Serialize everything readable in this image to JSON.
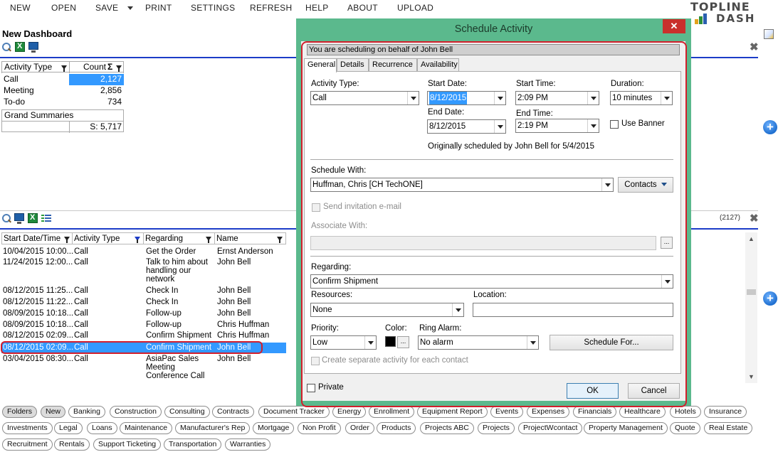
{
  "menu": {
    "items": [
      "NEW",
      "OPEN",
      "SAVE",
      "PRINT",
      "SETTINGS",
      "REFRESH",
      "HELP",
      "ABOUT",
      "UPLOAD"
    ]
  },
  "logo": {
    "line1": "TopLine",
    "line2": "Dash"
  },
  "dashboard": {
    "title": "New Dashboard",
    "pivot": {
      "col_activity": "Activity Type",
      "col_count": "Count",
      "rows": [
        {
          "type": "Call",
          "count": "2,127",
          "selected": true
        },
        {
          "type": "Meeting",
          "count": "2,856"
        },
        {
          "type": "To-do",
          "count": "734"
        }
      ],
      "grand_label": "Grand Summaries",
      "grand_value": "S: 5,717"
    },
    "list": {
      "count_badge": "(2127)",
      "headers": [
        "Start Date/Time",
        "Activity Type",
        "Regarding",
        "Name"
      ],
      "rows": [
        [
          "10/04/2015  10:00...",
          "Call",
          "Get the Order",
          "Ernst Anderson"
        ],
        [
          "11/24/2015  12:00...",
          "Call",
          "Talk to him about handling our network",
          "John Bell"
        ],
        [
          "08/12/2015  11:25...",
          "Call",
          "Check In",
          "John Bell"
        ],
        [
          "08/12/2015  11:22...",
          "Call",
          "Check In",
          "John Bell"
        ],
        [
          "08/09/2015  10:18...",
          "Call",
          "Follow-up",
          "John Bell"
        ],
        [
          "08/09/2015  10:18...",
          "Call",
          "Follow-up",
          "Chris Huffman"
        ],
        [
          "08/12/2015  02:09...",
          "Call",
          "Confirm Shipment",
          "Chris Huffman"
        ],
        [
          "08/12/2015  02:09...",
          "Call",
          "Confirm Shipment",
          "John Bell"
        ],
        [
          "03/04/2015  08:30...",
          "Call",
          "AsiaPac Sales Meeting Conference Call",
          "John Bell"
        ]
      ],
      "selected_index": 7
    }
  },
  "tags": {
    "row1": [
      "Folders",
      "New",
      "Banking",
      "Construction",
      "Consulting",
      "Contracts",
      "Document Tracker",
      "Energy",
      "Enrollment",
      "Equipment Report",
      "Events",
      "Expenses",
      "Financials",
      "Healthcare",
      "Hotels",
      "Insurance"
    ],
    "row2": [
      "Investments",
      "Legal",
      "Loans",
      "Maintenance",
      "Manufacturer's Rep",
      "Mortgage",
      "Non Profit",
      "Order",
      "Products",
      "Projects ABC",
      "Projects",
      "ProjectWcontact",
      "Property Management",
      "Quote",
      "Real Estate"
    ],
    "row3": [
      "Recruitment",
      "Rentals",
      "Support Ticketing",
      "Transportation",
      "Warranties"
    ],
    "active": [
      "Folders",
      "New"
    ]
  },
  "dialog": {
    "title": "Schedule Activity",
    "close": "✕",
    "behalf": "You are scheduling on behalf of John Bell",
    "tabs": [
      "General",
      "Details",
      "Recurrence",
      "Availability"
    ],
    "activity_type_label": "Activity Type:",
    "activity_type": "Call",
    "start_date_label": "Start Date:",
    "start_date": "8/12/2015",
    "start_time_label": "Start Time:",
    "start_time": "2:09 PM",
    "duration_label": "Duration:",
    "duration": "10 minutes",
    "end_date_label": "End Date:",
    "end_date": "8/12/2015",
    "end_time_label": "End Time:",
    "end_time": "2:19 PM",
    "use_banner": "Use Banner",
    "originally": "Originally scheduled by John Bell for 5/4/2015",
    "schedule_with_label": "Schedule With:",
    "schedule_with": "Huffman, Chris [CH TechONE]",
    "contacts_btn": "Contacts",
    "send_invite": "Send invitation e-mail",
    "associate_label": "Associate With:",
    "ellipsis": "...",
    "regarding_label": "Regarding:",
    "regarding": "Confirm Shipment",
    "resources_label": "Resources:",
    "resources": "None",
    "location_label": "Location:",
    "priority_label": "Priority:",
    "priority": "Low",
    "color_label": "Color:",
    "ring_alarm_label": "Ring Alarm:",
    "ring_alarm": "No alarm",
    "schedule_for_btn": "Schedule For...",
    "separate_activity": "Create separate activity for each contact",
    "private": "Private",
    "ok": "OK",
    "cancel": "Cancel"
  }
}
